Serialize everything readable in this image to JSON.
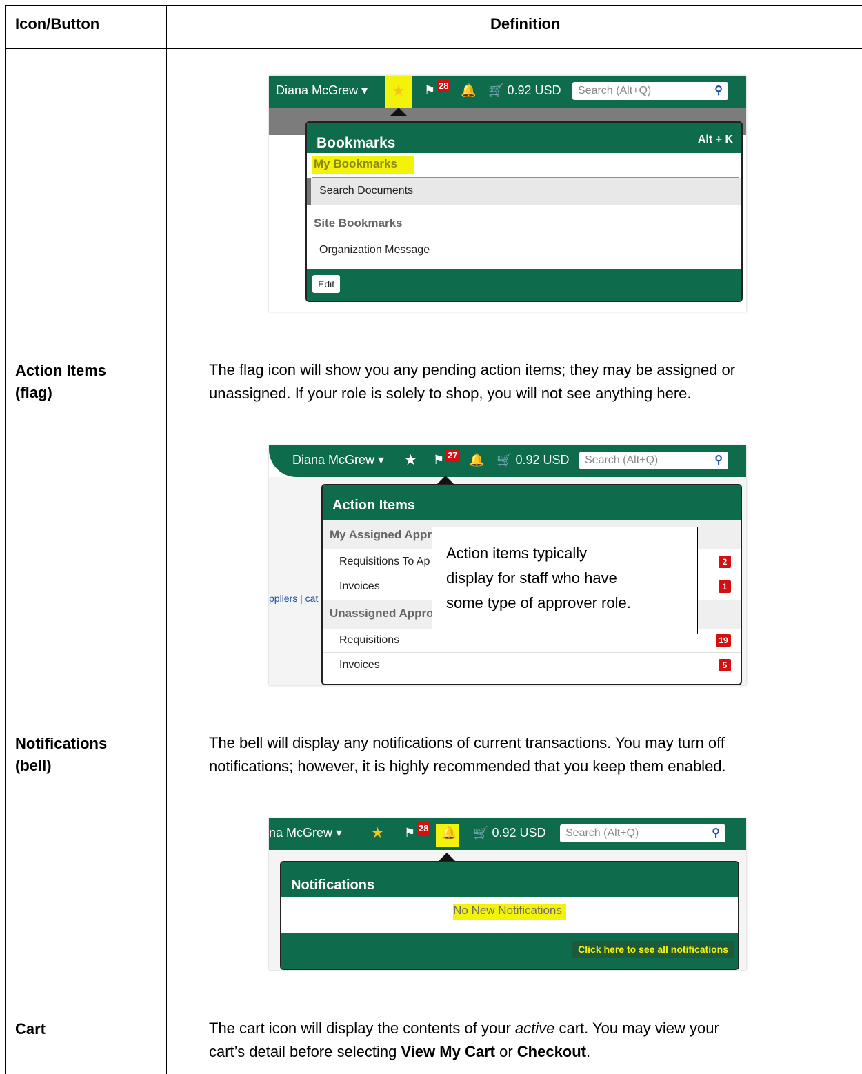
{
  "table": {
    "header_term": "Icon/Button",
    "header_definition": "Definition"
  },
  "topbar": {
    "user": "Diana McGrew",
    "user_partial": "na McGrew",
    "badge_28": "28",
    "badge_27": "27",
    "cart_amount": "0.92 USD",
    "search_placeholder": "Search (Alt+Q)"
  },
  "bookmarks": {
    "title": "Bookmarks",
    "shortcut": "Alt + K",
    "my_section": "My Bookmarks",
    "item1": "Search Documents",
    "site_section": "Site Bookmarks",
    "item2": "Organization Message",
    "edit_button": "Edit"
  },
  "action_items_row": {
    "term_line1": "Action Items",
    "term_line2": "(flag)",
    "desc_line1": "The flag icon will show you any pending action items; they may be assigned or",
    "desc_line2": "unassigned. If your role is solely to shop, you will not see anything here."
  },
  "action_items": {
    "title": "Action Items",
    "sec_assigned": "My Assigned Appr",
    "req_to_approve": "Requisitions To Ap",
    "req_badge": "2",
    "invoices": "Invoices",
    "inv_badge": "1",
    "sec_unassigned": "Unassigned Appro",
    "requisitions": "Requisitions",
    "un_req_badge": "19",
    "un_inv_badge": "5",
    "bg_link_text": "ppliers | cat",
    "callout_l1": "Action items typically",
    "callout_l2": "display for staff who have",
    "callout_l3": "some type of approver role."
  },
  "notifications_row": {
    "term_line1": "Notifications",
    "term_line2": "(bell)",
    "desc_line1": "The bell will display any notifications of current transactions. You may turn off",
    "desc_line2": "notifications; however, it is highly recommended that you keep them enabled."
  },
  "notifications": {
    "title": "Notifications",
    "empty": "No New Notifications",
    "see_all": "Click here to see all notifications"
  },
  "cart_row": {
    "term": "Cart",
    "desc_pre": "The cart icon will display the contents of your ",
    "desc_em": "active",
    "desc_mid": " cart. You may view your",
    "desc_l2_pre": "cart’s detail before selecting ",
    "desc_b1": "View My Cart",
    "desc_or": " or ",
    "desc_b2": "Checkout",
    "desc_end": "."
  },
  "colors": {
    "brand_green": "#0e6b4b",
    "badge_red": "#d40f0f",
    "highlight_yellow": "#f3f20a"
  },
  "icons": [
    "star-icon",
    "flag-icon",
    "bell-icon",
    "cart-icon",
    "search-icon",
    "caret-down-icon"
  ]
}
